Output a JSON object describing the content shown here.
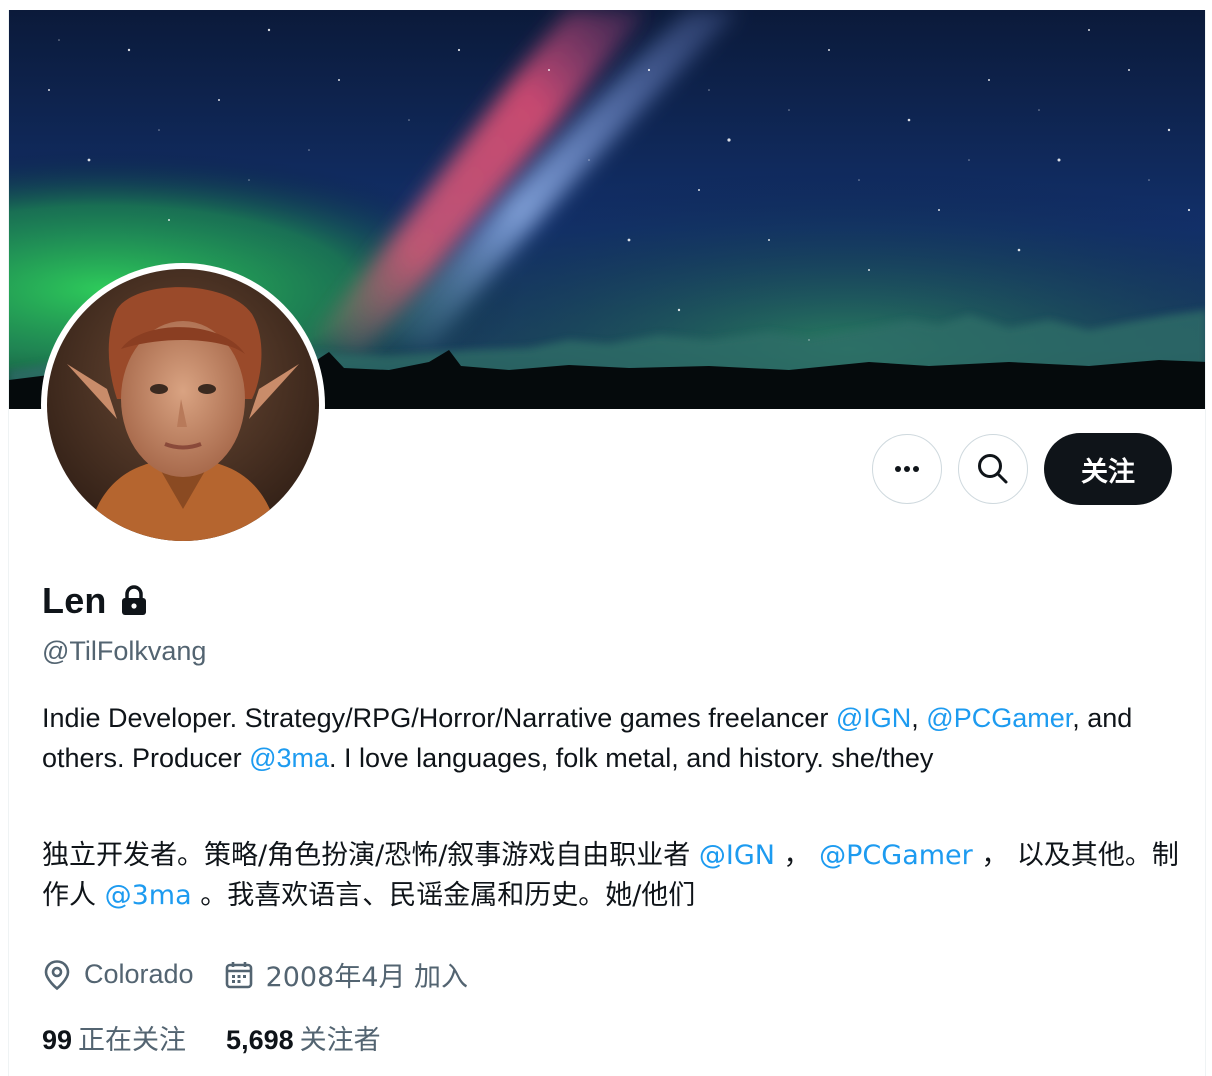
{
  "profile": {
    "display_name": "Len",
    "handle": "@TilFolkvang",
    "bio_en": {
      "p1": "Indie Developer. Strategy/RPG/Horror/Narrative games freelancer ",
      "m1": "@IGN",
      "p2": ", ",
      "m2": "@PCGamer",
      "p3": ", and others. Producer ",
      "m3": "@3ma",
      "p4": ". I love languages, folk metal, and history. she/they"
    },
    "bio_zh": {
      "p1": "独立开发者。策略/角色扮演/恐怖/叙事游戏自由职业者 ",
      "m1": "@IGN",
      "p2": " ， ",
      "m2": "@PCGamer",
      "p3": " ， 以及其他。制作人 ",
      "m3": "@3ma",
      "p4": " 。我喜欢语言、民谣金属和历史。她/他们"
    },
    "location": "Colorado",
    "joined": "2008年4月 加入",
    "following_count": "99",
    "following_label": "正在关注",
    "followers_count": "5,698",
    "followers_label": "关注者"
  },
  "actions": {
    "follow_label": "关注"
  },
  "icons": {
    "more": "more-icon",
    "search": "search-icon",
    "lock": "lock-icon",
    "location": "location-icon",
    "calendar": "calendar-icon"
  },
  "colors": {
    "accent": "#1d9bf0",
    "text": "#0f1419",
    "secondary": "#536471",
    "follow_bg": "#0f1419"
  }
}
